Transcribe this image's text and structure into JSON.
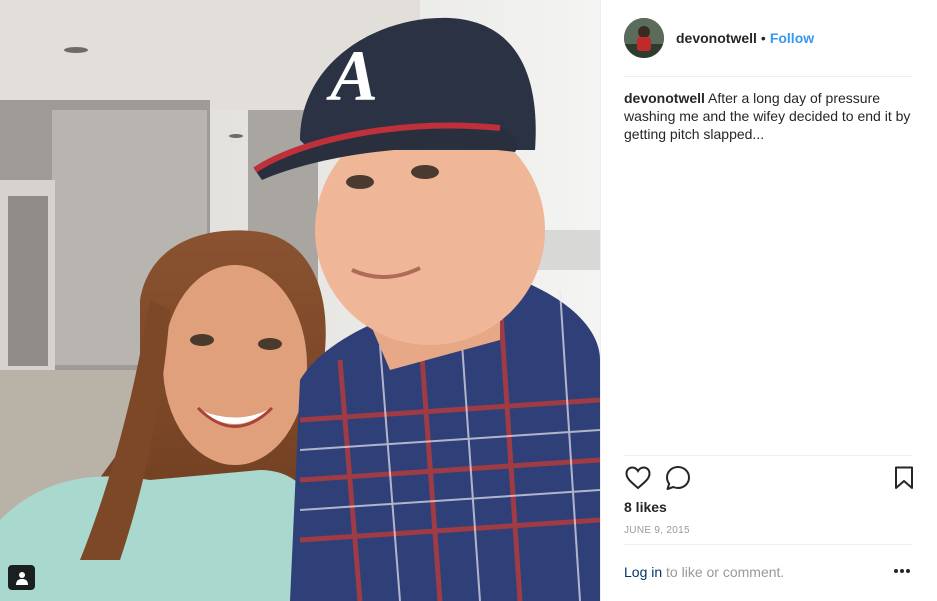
{
  "post": {
    "author": {
      "username": "devonotwell",
      "follow_label": "Follow",
      "separator": "•"
    },
    "caption": {
      "username": "devonotwell",
      "text": "After a long day of pressure washing me and the wifey decided to end it by getting pitch slapped..."
    },
    "actions": {
      "like_icon": "heart-icon",
      "comment_icon": "comment-icon",
      "save_icon": "bookmark-icon"
    },
    "likes_text": "8 likes",
    "date_text": "JUNE 9, 2015",
    "login_link": "Log in",
    "login_suffix": " to like or comment.",
    "more_icon": "more-options-icon",
    "tag_icon": "user-tag-icon"
  },
  "colors": {
    "accent": "#3897f0",
    "link_dark": "#003569",
    "muted": "#999999",
    "text": "#262626"
  }
}
